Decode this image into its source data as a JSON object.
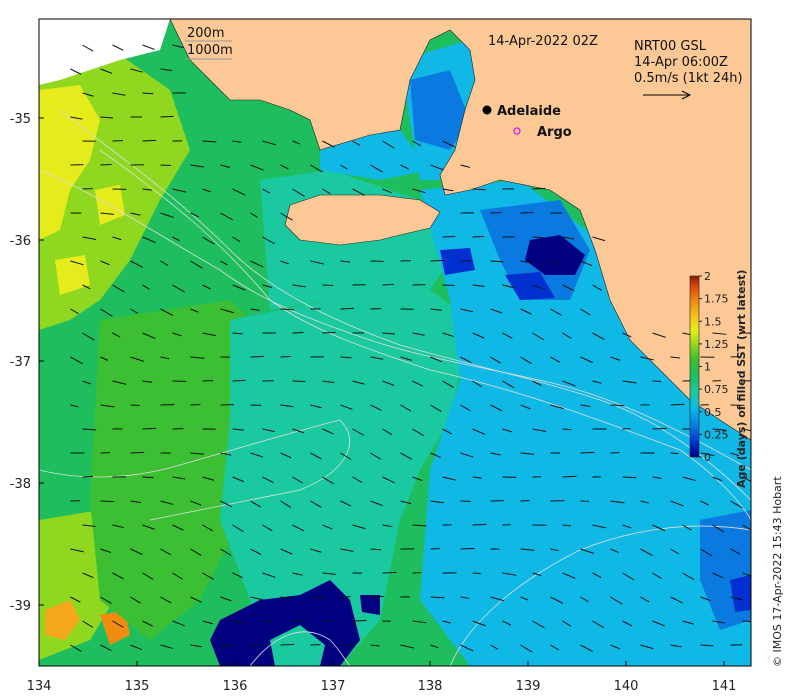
{
  "map": {
    "date_label": "14-Apr-2022 02Z",
    "contour_labels": [
      "200m",
      "1000m"
    ],
    "current_source": "NRT00 GSL",
    "current_time": "14-Apr 06:00Z",
    "current_scale": "0.5m/s (1kt 24h)",
    "places": [
      {
        "name": "Adelaide",
        "marker": "dot"
      },
      {
        "name": "Argo",
        "marker": "ring"
      }
    ],
    "credit": "© IMOS 17-Apr-2022 15:43 Hobart",
    "x_ticks": [
      "134",
      "135",
      "136",
      "137",
      "138",
      "139",
      "140",
      "141"
    ],
    "y_ticks": [
      "-35",
      "-36",
      "-37",
      "-38",
      "-39"
    ],
    "colors": {
      "land": "#fcc896",
      "scale_arrow": "#000000"
    }
  },
  "colorbar": {
    "title": "Age (days) of filled SST (wrt latest)",
    "ticks": [
      "2",
      "1.75",
      "1.5",
      "1.25",
      "1",
      "0.75",
      "0.5",
      "0.25",
      "0"
    ],
    "colors": [
      "#000080",
      "#0030d0",
      "#0a7ae0",
      "#10b8e6",
      "#1ac9a0",
      "#1ebd5e",
      "#3cbf32",
      "#90d820",
      "#e6ec1c",
      "#f5c01c",
      "#f08c10",
      "#dc4a0c",
      "#8a1a0a"
    ]
  }
}
